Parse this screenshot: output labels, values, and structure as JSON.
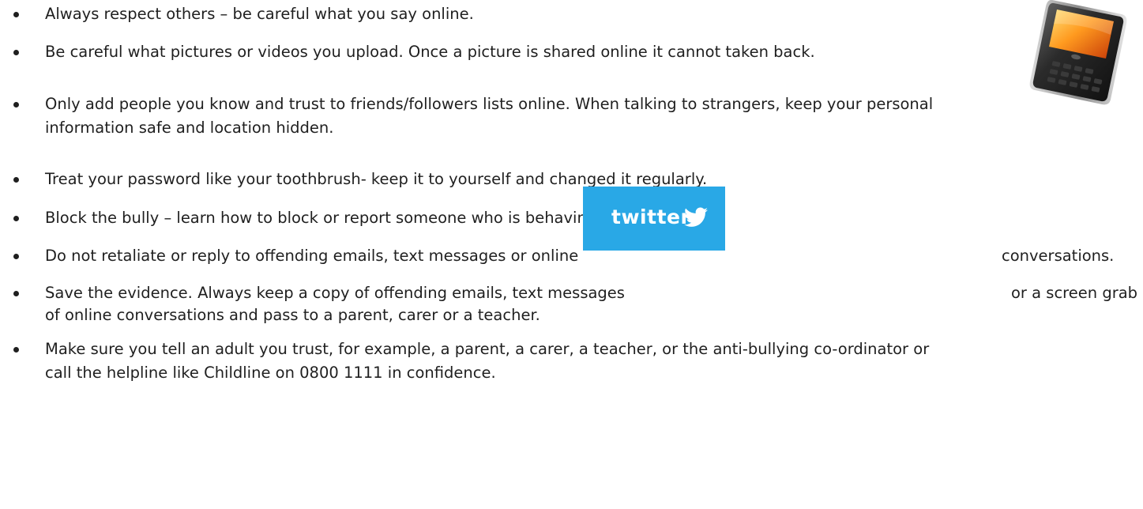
{
  "items": [
    {
      "text": "Always respect others – be careful what you say online."
    },
    {
      "text": "Be careful what pictures or videos you upload. Once a picture is shared online it cannot taken back."
    },
    {
      "line1": "Only add people you know and trust to friends/followers lists online. When talking to strangers, keep your personal",
      "line2": "information safe and location hidden."
    },
    {
      "text": "Treat your password like your toothbrush- keep it to yourself and changed it regularly."
    },
    {
      "text": "Block the bully – learn how to block or report someone who is behaving badly."
    },
    {
      "left": "Do not retaliate or reply to offending emails, text messages or online",
      "right": "conversations."
    },
    {
      "left": "Save the evidence. Always keep a copy of offending emails, text messages",
      "right": "or a screen grab",
      "line2": "of online conversations and pass to a parent, carer or a teacher."
    },
    {
      "line1": "Make sure you tell an adult you trust, for example, a parent, a carer, a teacher, or the anti-bullying co-ordinator or",
      "line2": "call the helpline like Childline on 0800 1111 in confidence."
    }
  ],
  "images": {
    "twitter_logo_text": "twitter",
    "phone_icon": "smartphone-icon",
    "bird_icon": "twitter-bird-icon"
  },
  "colors": {
    "text": "#1f1f1f",
    "twitter_blue": "#29a8e6"
  }
}
